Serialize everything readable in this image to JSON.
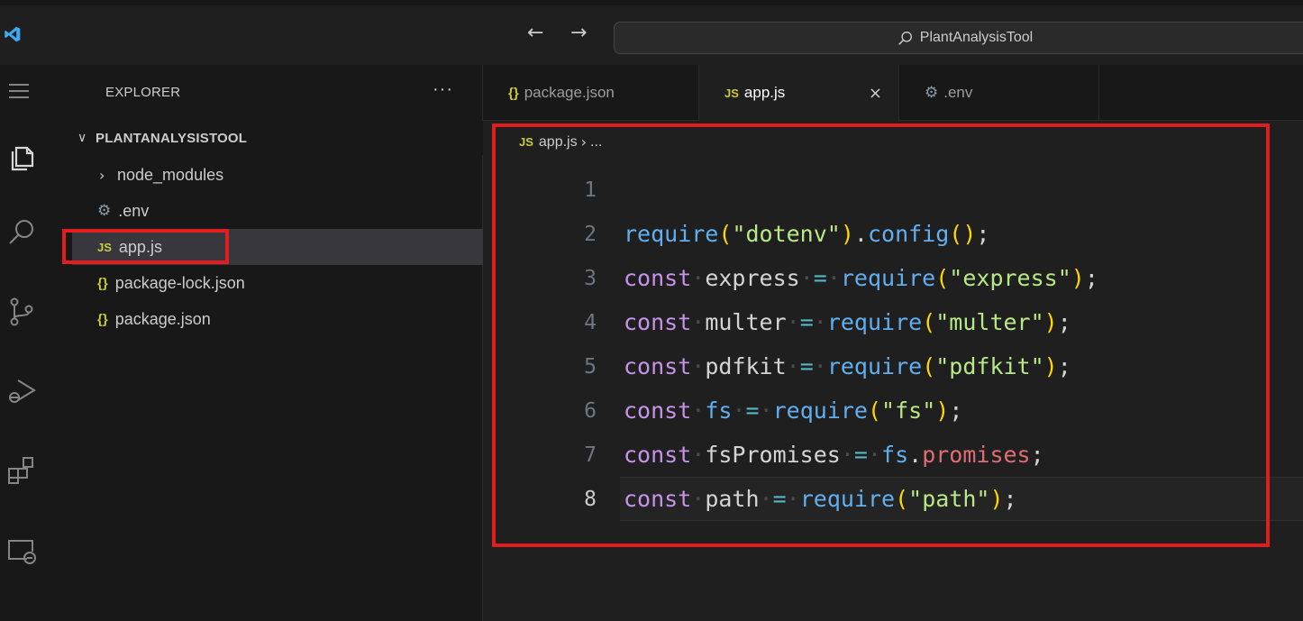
{
  "titlebar": {
    "search_text": "PlantAnalysisTool",
    "back_arrow": "←",
    "forward_arrow": "→"
  },
  "sidebar": {
    "title": "EXPLORER",
    "more": "···",
    "section": {
      "chevron": "∨",
      "name": "PLANTANALYSISTOOL"
    },
    "items": [
      {
        "label": "node_modules",
        "type": "folder",
        "chevron": "›"
      },
      {
        "label": ".env",
        "type": "env",
        "icon": "⚙"
      },
      {
        "label": "app.js",
        "type": "js",
        "icon": "JS"
      },
      {
        "label": "package-lock.json",
        "type": "json",
        "icon": "{}"
      },
      {
        "label": "package.json",
        "type": "json",
        "icon": "{}"
      }
    ]
  },
  "tabs": [
    {
      "label": "package.json",
      "icon": "{}"
    },
    {
      "label": "app.js",
      "icon": "JS",
      "close": "×"
    },
    {
      "label": ".env",
      "icon": "⚙"
    }
  ],
  "breadcrumb": {
    "icon": "JS",
    "file": "app.js",
    "sep": "›",
    "rest": "..."
  },
  "code": {
    "line_numbers": [
      "1",
      "2",
      "3",
      "4",
      "5",
      "6",
      "7",
      "8"
    ],
    "lines": [
      "",
      "require(\"dotenv\").config();",
      "const express = require(\"express\");",
      "const multer = require(\"multer\");",
      "const pdfkit = require(\"pdfkit\");",
      "const fs = require(\"fs\");",
      "const fsPromises = fs.promises;",
      "const path = require(\"path\");"
    ],
    "current_line": 8
  },
  "colors": {
    "accent": "#0078d4",
    "highlight_box": "#e11d1d",
    "js_icon": "#cbcb41"
  }
}
